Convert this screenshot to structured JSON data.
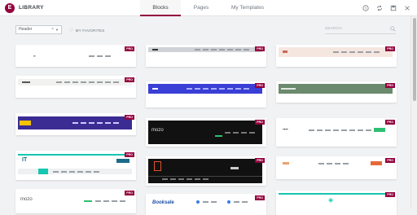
{
  "header": {
    "logo_letter": "E",
    "title": "LIBRARY",
    "tabs": [
      {
        "label": "Blocks",
        "active": true
      },
      {
        "label": "Pages",
        "active": false
      },
      {
        "label": "My Templates",
        "active": false
      }
    ],
    "icons": [
      "help-icon",
      "sync-icon",
      "save-icon",
      "close-icon"
    ]
  },
  "filters": {
    "category_value": "Header",
    "clear_symbol": "×",
    "favorites_label": "MY FAVORITES",
    "search_placeholder": "SEARCH"
  },
  "badge_label": "PRO",
  "cards": {
    "c2_brand": "mozo",
    "c3_brand": "IT",
    "c4_logo": "L",
    "c5_brand": "Booksale",
    "c6_brand": "mozo",
    "c7_logo": "M"
  },
  "colors": {
    "accent": "#93003c",
    "purple_banner": "#3b2c94",
    "blue_bar": "#3a3fd6",
    "sage_bar": "#6b8a6e",
    "teal": "#16c6b0",
    "dark": "#111111"
  }
}
